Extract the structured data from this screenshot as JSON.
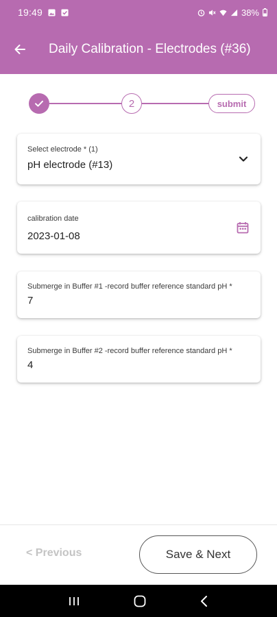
{
  "status_bar": {
    "time": "19:49",
    "battery": "38%"
  },
  "app_bar": {
    "back_icon": "arrow-left-icon",
    "title": "Daily Calibration - Electrodes (#36)"
  },
  "stepper": {
    "step1_icon": "check-icon",
    "step2_label": "2",
    "submit_label": "submit"
  },
  "form": {
    "electrode": {
      "label": "Select electrode  * (1)",
      "value": "pH electrode  (#13)",
      "trailing_icon": "chevron-down-icon"
    },
    "calibration_date": {
      "label": "calibration date",
      "value": "2023-01-08",
      "trailing_icon": "calendar-icon"
    },
    "buffer1": {
      "label": "Submerge in Buffer #1 -record buffer reference standard pH  *",
      "value": "7"
    },
    "buffer2": {
      "label": "Submerge in Buffer #2 -record buffer reference standard pH  *",
      "value": "4"
    }
  },
  "footer": {
    "previous_label": "< Previous",
    "next_label": "Save & Next"
  },
  "colors": {
    "accent": "#b76bb0",
    "disabled_text": "#c4c4c4"
  }
}
